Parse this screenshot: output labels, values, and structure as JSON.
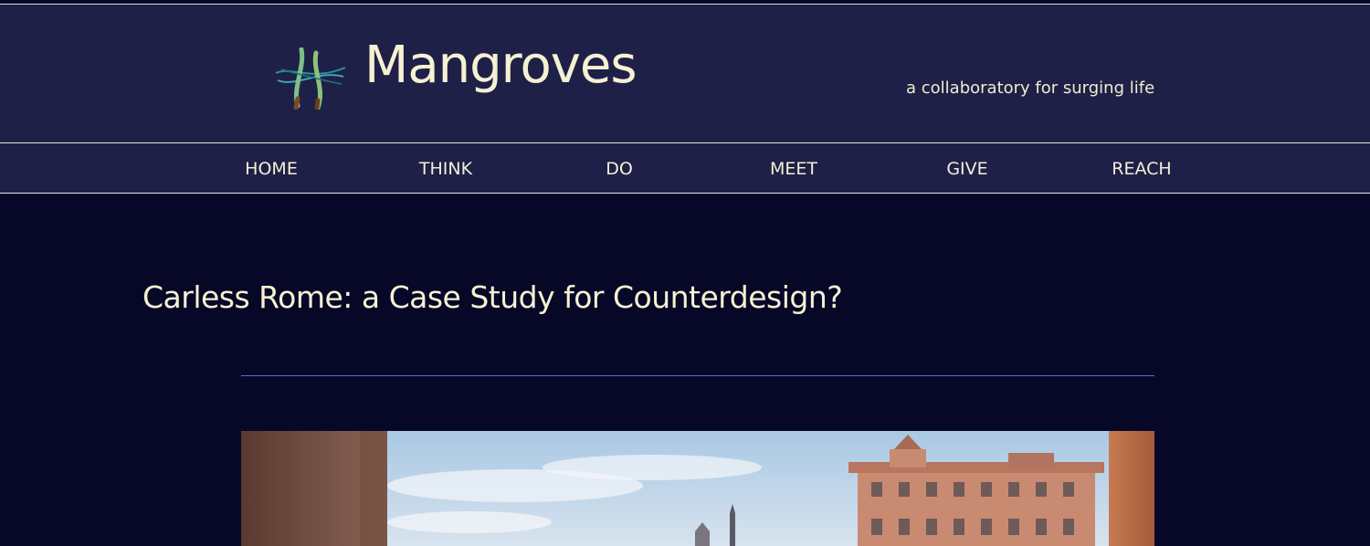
{
  "header": {
    "site_name": "Mangroves",
    "tagline": "a collaboratory for surging life",
    "logo_icon": "mangrove-roots-icon"
  },
  "nav": {
    "items": [
      "HOME",
      "THINK",
      "DO",
      "MEET",
      "GIVE",
      "REACH"
    ]
  },
  "post": {
    "title": "Carless Rome: a Case Study for Counterdesign?",
    "hero_image": "rome-street-photo"
  },
  "colors": {
    "header_bg": "#1f2047",
    "page_bg": "#070828",
    "text_cream": "#f6f1d2",
    "divider_blue": "#5d6bbd"
  }
}
